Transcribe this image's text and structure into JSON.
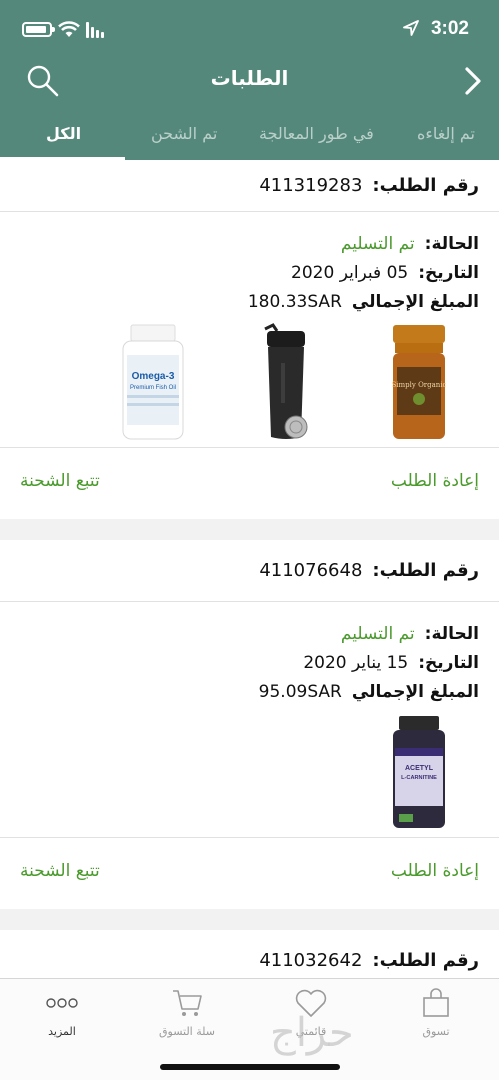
{
  "status_bar": {
    "time": "3:02"
  },
  "header": {
    "title": "الطلبات"
  },
  "tabs": [
    {
      "label": "الكل"
    },
    {
      "label": "تم الشحن"
    },
    {
      "label": "في طور المعالجة"
    },
    {
      "label": "تم إلغاءه"
    }
  ],
  "labels": {
    "order_number": "رقم الطلب:",
    "status": "الحالة:",
    "date": "التاريخ:",
    "total": "المبلغ الإجمالي",
    "reorder": "إعادة الطلب",
    "track": "تتبع الشحنة"
  },
  "orders": [
    {
      "number": "411319283"
    },
    {
      "number": "411076648",
      "status": "تم التسليم",
      "date": "05 فبراير 2020",
      "total": "180.33SAR",
      "products": [
        {
          "name": "simply organic spice jar",
          "label": "Simply Organic"
        },
        {
          "name": "shaker bottle"
        },
        {
          "name": "omega-3 bottle",
          "label": "Omega-3",
          "sublabel": "Premium Fish Oil"
        }
      ]
    },
    {
      "number": "411032642",
      "status": "تم التسليم",
      "date": "15 يناير 2020",
      "total": "95.09SAR",
      "products": [
        {
          "name": "acetyl l-carnitine bottle",
          "label": "ACETYL",
          "sublabel": "L-CARNITINE"
        }
      ]
    }
  ],
  "tabbar": [
    {
      "label": "تسوق",
      "icon": "bag-icon"
    },
    {
      "label": "قائمتي",
      "icon": "heart-icon"
    },
    {
      "label": "سلة التسوق",
      "icon": "cart-icon"
    },
    {
      "label": "المزيد",
      "icon": "more-icon"
    }
  ],
  "watermark": "حراج",
  "colors": {
    "header": "#54887a",
    "accent_green": "#4a9a2c"
  }
}
